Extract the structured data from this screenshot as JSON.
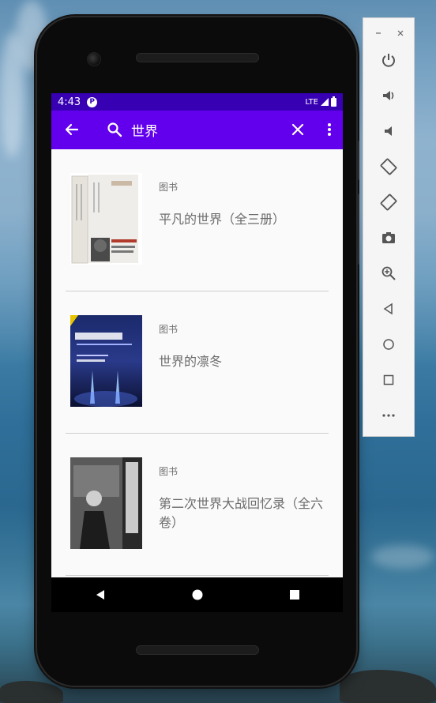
{
  "status_bar": {
    "time": "4:43",
    "notification_badge": "P",
    "network": "LTE"
  },
  "app_bar": {
    "query": "世界",
    "icons": [
      "back-arrow-icon",
      "search-icon",
      "close-icon",
      "more-vert-icon"
    ]
  },
  "results": [
    {
      "category": "图书",
      "title": "平凡的世界（全三册）"
    },
    {
      "category": "图书",
      "title": "世界的凛冬"
    },
    {
      "category": "图书",
      "title": "第二次世界大战回忆录（全六卷）"
    }
  ],
  "nav_bar": {
    "icons": [
      "back-triangle-icon",
      "home-circle-icon",
      "recents-square-icon"
    ]
  },
  "emulator_toolbar": {
    "icons": [
      "minimize-icon",
      "close-icon",
      "power-icon",
      "volume-up-icon",
      "volume-down-icon",
      "rotate-left-icon",
      "rotate-right-icon",
      "camera-icon",
      "zoom-icon",
      "back-icon",
      "home-icon",
      "overview-icon",
      "more-icon"
    ]
  },
  "colors": {
    "status_bar": "#3700b3",
    "app_bar": "#6200ee",
    "screen_bg": "#fafafa"
  }
}
